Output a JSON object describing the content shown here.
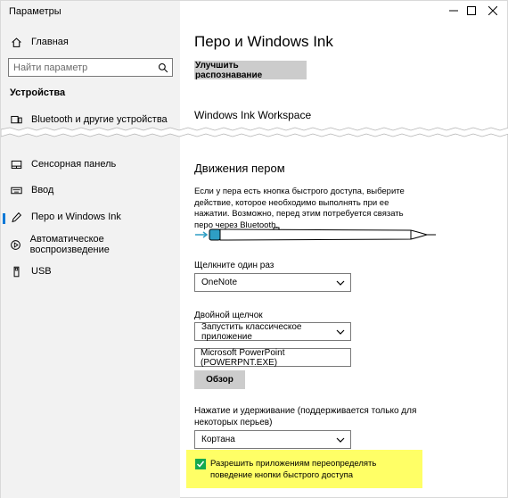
{
  "window": {
    "title": "Параметры"
  },
  "sidebar": {
    "home_label": "Главная",
    "search_placeholder": "Найти параметр",
    "section_heading": "Устройства",
    "items": [
      {
        "label": "Bluetooth и другие устройства",
        "icon": "bluetooth-devices-icon"
      },
      {
        "label": "Сенсорная панель",
        "icon": "touchpad-icon"
      },
      {
        "label": "Ввод",
        "icon": "keyboard-icon"
      },
      {
        "label": "Перо и Windows Ink",
        "icon": "pen-icon",
        "active": true
      },
      {
        "label": "Автоматическое воспроизведение",
        "icon": "autoplay-icon"
      },
      {
        "label": "USB",
        "icon": "usb-icon"
      }
    ]
  },
  "main": {
    "page_title": "Перо и Windows Ink",
    "improve_button": "Улучшить распознавание",
    "workspace_heading": "Windows Ink Workspace",
    "pen_shortcuts_heading": "Движения пером",
    "description": "Если у пера есть кнопка быстрого доступа, выберите действие, которое необходимо выполнять при ее нажатии. Возможно, перед этим потребуется связать перо через Bluetooth.",
    "single_click": {
      "label": "Щелкните один раз",
      "value": "OneNote"
    },
    "double_click": {
      "label": "Двойной щелчок",
      "value": "Запустить классическое приложение",
      "app_path": "Microsoft PowerPoint (POWERPNT.EXE)",
      "browse_button": "Обзор"
    },
    "press_hold": {
      "label": "Нажатие и удерживание (поддерживается только для некоторых перьев)",
      "value": "Кортана"
    },
    "override_checkbox": {
      "label": "Разрешить приложениям переопределять поведение кнопки быстрого доступа",
      "checked": true
    }
  },
  "colors": {
    "accent": "#0078d7",
    "pen_accent": "#2e9ec4",
    "checkbox": "#15a94f",
    "highlight": "#ffff66",
    "sidebar_bg": "#f2f2f2"
  }
}
